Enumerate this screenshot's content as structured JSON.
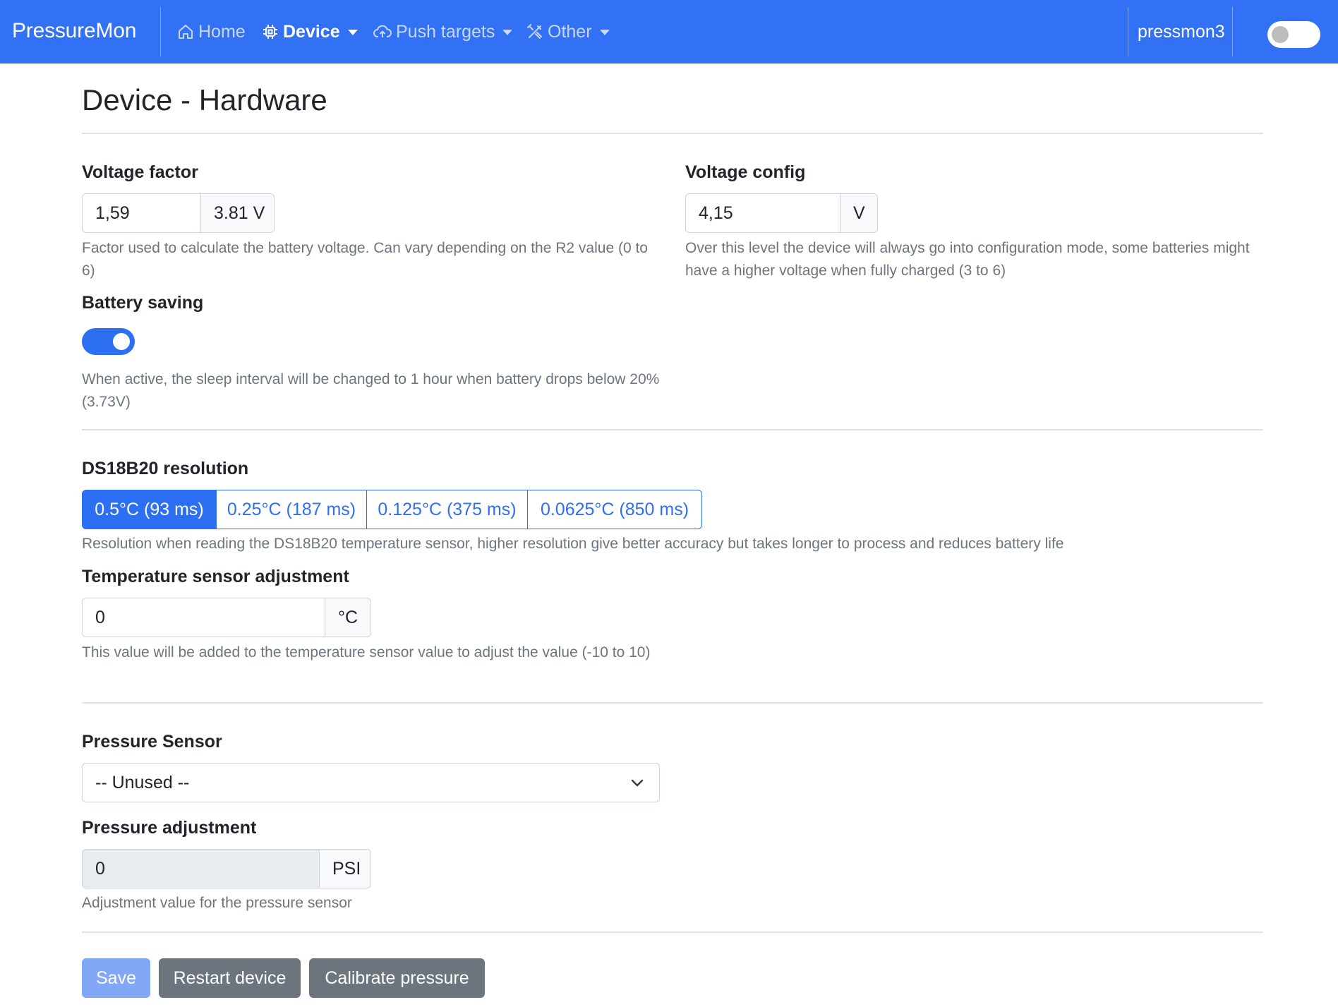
{
  "navbar": {
    "brand": "PressureMon",
    "items": [
      {
        "label": "Home",
        "icon": "home-icon",
        "active": false
      },
      {
        "label": "Device",
        "icon": "chip-icon",
        "active": true
      },
      {
        "label": "Push targets",
        "icon": "cloud-upload-icon",
        "active": false
      },
      {
        "label": "Other",
        "icon": "tools-icon",
        "active": false
      }
    ],
    "hostname": "pressmon3",
    "accent_color": "#3270f4"
  },
  "page": {
    "title": "Device - Hardware"
  },
  "voltage_factor": {
    "label": "Voltage factor",
    "value": "1,59",
    "addon": "3.81 V",
    "help": "Factor used to calculate the battery voltage. Can vary depending on the R2 value (0 to 6)"
  },
  "voltage_config": {
    "label": "Voltage config",
    "value": "4,15",
    "addon": "V",
    "help": "Over this level the device will always go into configuration mode, some batteries might have a higher voltage when fully charged (3 to 6)"
  },
  "battery_saving": {
    "label": "Battery saving",
    "enabled": true,
    "help": "When active, the sleep interval will be changed to 1 hour when battery drops below 20% (3.73V)"
  },
  "ds18b20": {
    "label": "DS18B20 resolution",
    "options": [
      "0.5°C (93 ms)",
      "0.25°C (187 ms)",
      "0.125°C (375 ms)",
      "0.0625°C (850 ms)"
    ],
    "selected": "0.5°C (93 ms)",
    "help": "Resolution when reading the DS18B20 temperature sensor, higher resolution give better accuracy but takes longer to process and reduces battery life"
  },
  "temp_adjust": {
    "label": "Temperature sensor adjustment",
    "value": "0",
    "addon": "°C",
    "help": "This value will be added to the temperature sensor value to adjust the value (-10 to 10)"
  },
  "pressure_sensor": {
    "label": "Pressure Sensor",
    "selected": "-- Unused --"
  },
  "pressure_adjust": {
    "label": "Pressure adjustment",
    "value": "0",
    "addon": "PSI",
    "help": "Adjustment value for the pressure sensor"
  },
  "actions": {
    "save": "Save",
    "restart": "Restart device",
    "calibrate": "Calibrate pressure"
  }
}
